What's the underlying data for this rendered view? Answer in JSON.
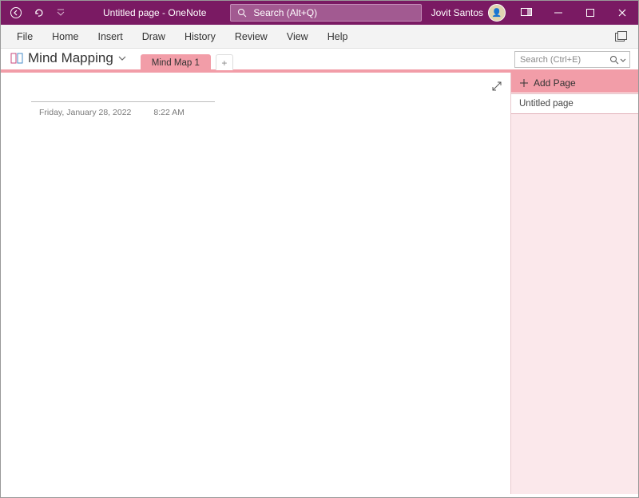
{
  "titlebar": {
    "title": "Untitled page  -  OneNote",
    "search_placeholder": "Search (Alt+Q)",
    "user_name": "Jovit Santos"
  },
  "ribbon": {
    "items": [
      "File",
      "Home",
      "Insert",
      "Draw",
      "History",
      "Review",
      "View",
      "Help"
    ]
  },
  "notebook": {
    "name": "Mind Mapping",
    "section_tab": "Mind Map 1",
    "page_search_placeholder": "Search (Ctrl+E)"
  },
  "pagepane": {
    "add_page_label": "Add Page",
    "pages": [
      "Untitled page"
    ]
  },
  "canvas": {
    "date": "Friday, January 28, 2022",
    "time": "8:22 AM"
  }
}
